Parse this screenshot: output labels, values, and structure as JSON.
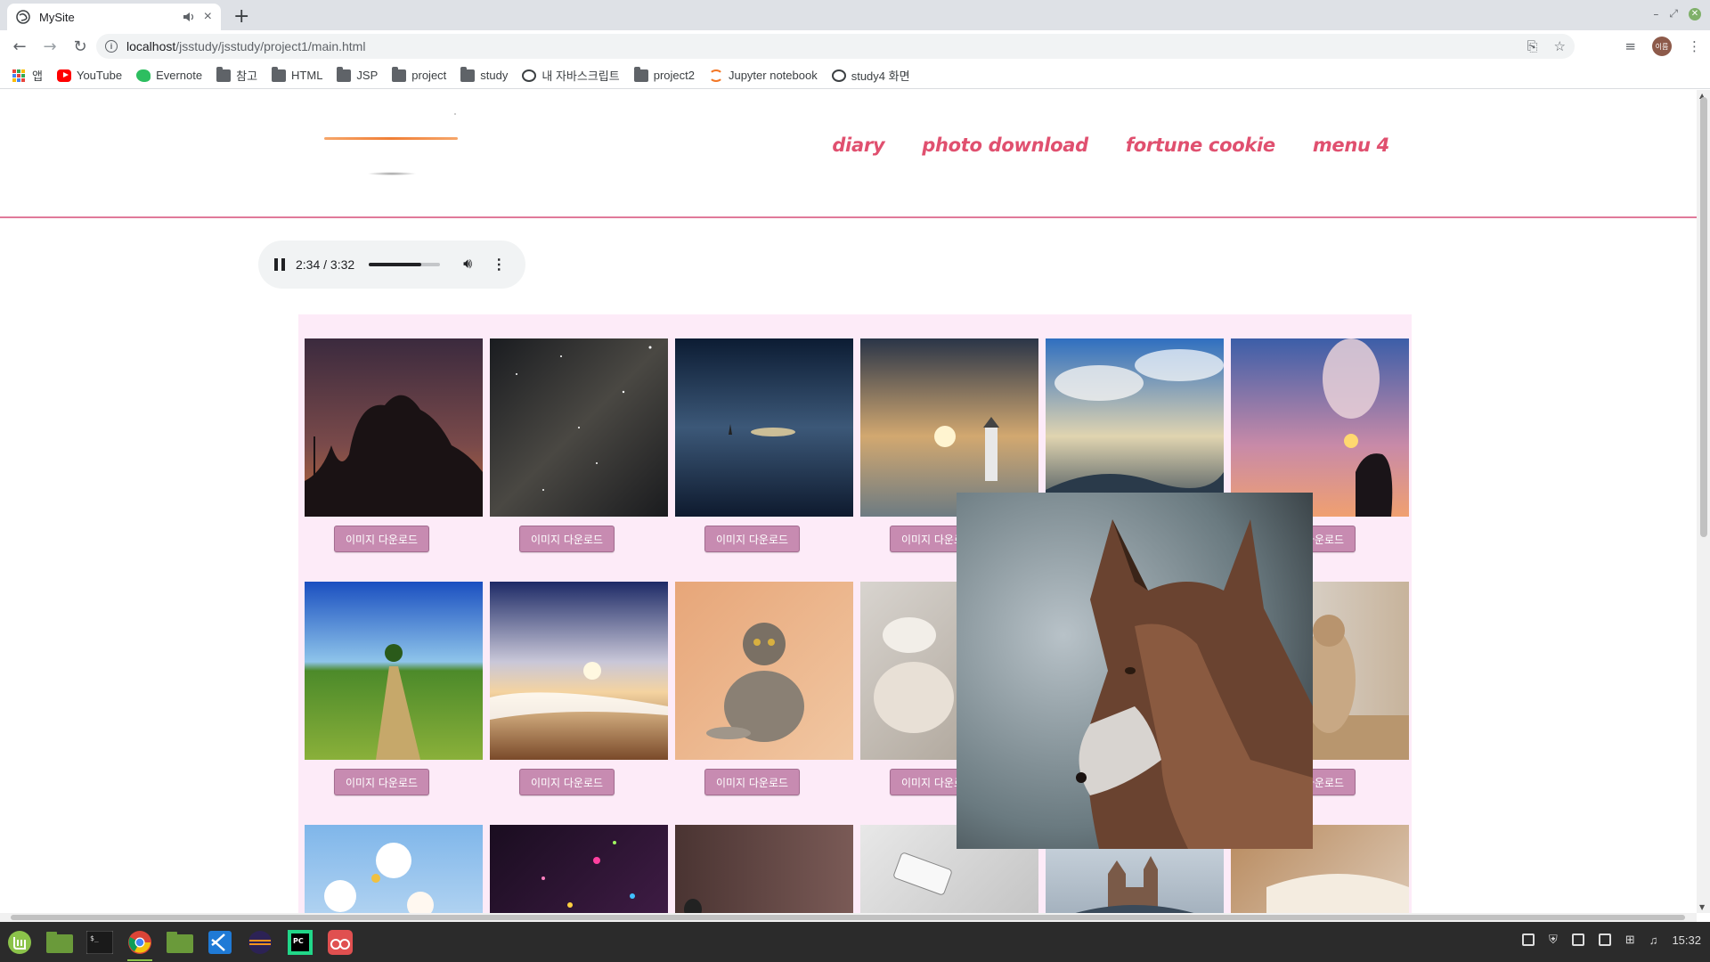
{
  "browser": {
    "tab_title": "MySite",
    "new_tab_glyph": "+",
    "url_host": "localhost",
    "url_path": "/jsstudy/jsstudy/project1/main.html",
    "profile_initial": "이름",
    "bookmarks": [
      {
        "label": "앱",
        "icon": "apps-icon"
      },
      {
        "label": "YouTube",
        "icon": "youtube-icon"
      },
      {
        "label": "Evernote",
        "icon": "evernote-icon"
      },
      {
        "label": "참고",
        "icon": "folder-icon"
      },
      {
        "label": "HTML",
        "icon": "folder-icon"
      },
      {
        "label": "JSP",
        "icon": "folder-icon"
      },
      {
        "label": "project",
        "icon": "folder-icon"
      },
      {
        "label": "study",
        "icon": "folder-icon"
      },
      {
        "label": "내 자바스크립트",
        "icon": "globe-icon"
      },
      {
        "label": "project2",
        "icon": "folder-icon"
      },
      {
        "label": "Jupyter notebook",
        "icon": "jupyter-icon"
      },
      {
        "label": "study4 화면",
        "icon": "globe-icon"
      }
    ]
  },
  "site": {
    "nav": [
      "diary",
      "photo download",
      "fortune cookie",
      "menu 4"
    ],
    "audio": {
      "time": "2:34 / 3:32",
      "progress": 0.73
    },
    "download_label": "이미지 다운로드",
    "colors": {
      "accent": "#e0506f",
      "gallery_bg": "#fdebf8",
      "button": "#c78bb1",
      "logo_bar": "#f07f36"
    }
  },
  "system": {
    "clock": "15:32"
  }
}
